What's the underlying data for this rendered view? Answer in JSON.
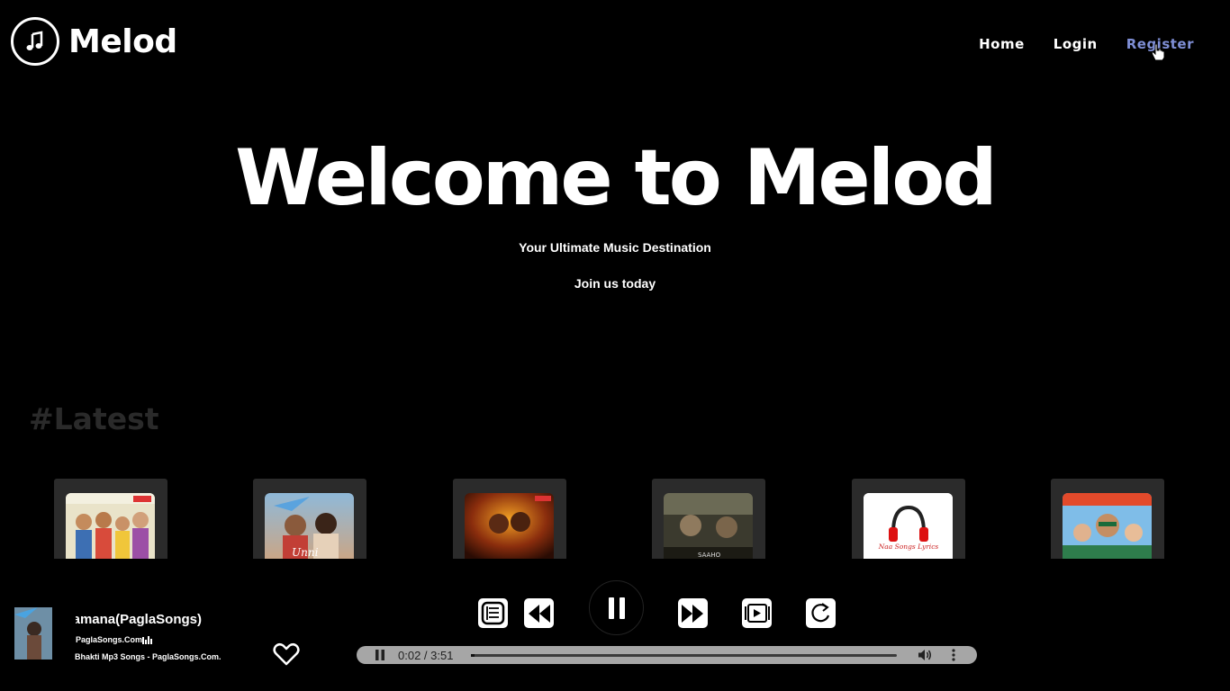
{
  "brand": {
    "name": "Melod",
    "logo_icon": "music-note-icon"
  },
  "nav": {
    "items": [
      {
        "label": "Home",
        "active": false
      },
      {
        "label": "Login",
        "active": false
      },
      {
        "label": "Register",
        "active": true
      }
    ],
    "active_color": "#7f8fd6"
  },
  "hero": {
    "title": "Welcome to Melod",
    "subtitle": "Your Ultimate Music Destination",
    "cta": "Join us today"
  },
  "latest": {
    "heading": "#Latest",
    "cards": [
      {
        "art": "album-cover-family-icon"
      },
      {
        "art": "album-cover-paper-plane-icon"
      },
      {
        "art": "album-cover-fire-icon"
      },
      {
        "art": "album-cover-poster-icon"
      },
      {
        "art": "album-cover-headphones-icon",
        "caption": "Naa Songs Lyrics"
      },
      {
        "art": "album-cover-oxygen-icon"
      }
    ]
  },
  "player": {
    "now_playing": {
      "title": "Thamana(PaglaSongs)",
      "source": "PaglaSongs.Com",
      "album": "Bhakti Mp3 Songs - PaglaSongs.Com."
    },
    "controls": [
      "playlist-icon",
      "rewind-icon",
      "pause-icon",
      "fast-forward-icon",
      "video-icon",
      "repeat-icon"
    ],
    "audio": {
      "time": "0:02 / 3:51",
      "progress": 0.009
    },
    "liked_icon": "heart-icon"
  },
  "colors": {
    "background": "#000000",
    "card": "#2b2b2b",
    "audio_bar": "#a6a6a6",
    "latest_heading": "#2a2a2a"
  }
}
